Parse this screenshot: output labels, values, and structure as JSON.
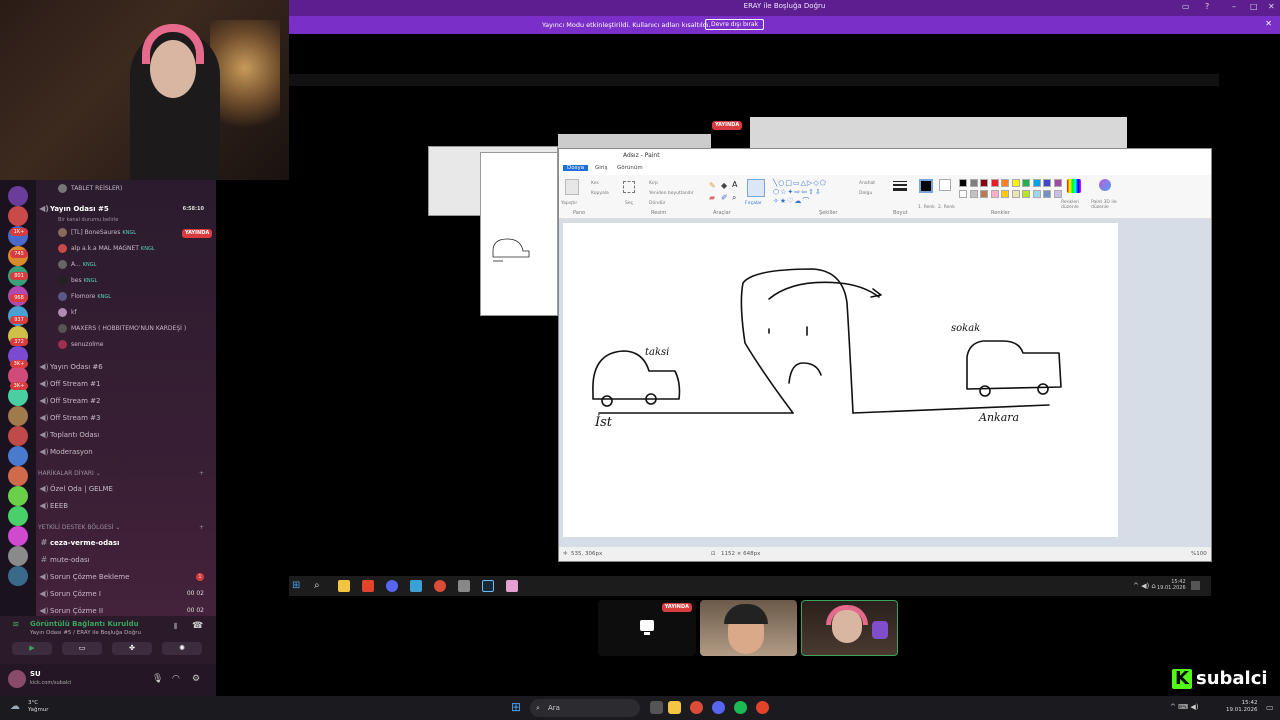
{
  "window": {
    "title": "ERAY ile Boşluğa Doğru",
    "notice_text": "Yayıncı Modu etkinleştirildi. Kullanıcı adları kısaltıldı.",
    "notice_button": "Devre dışı bırak"
  },
  "discord": {
    "channels": [
      {
        "label": "TABLET REİSLER)",
        "type": "voice-user"
      },
      {
        "label": "Yayın Odası #5",
        "type": "voice-active",
        "timer": "6:58:10",
        "subtitle": "Bir kanal durumu belirle"
      },
      {
        "label": "Yayın Odası #6",
        "type": "voice"
      },
      {
        "label": "Off Stream #1",
        "type": "voice"
      },
      {
        "label": "Off Stream #2",
        "type": "voice"
      },
      {
        "label": "Off Stream #3",
        "type": "voice"
      },
      {
        "label": "Toplantı Odası",
        "type": "voice"
      },
      {
        "label": "Moderasyon",
        "type": "voice"
      }
    ],
    "voice_users": [
      {
        "name": "[TL] BoneSaures",
        "tag": "KNGL",
        "live": "YAYINDA"
      },
      {
        "name": "alp a.k.a MAL MAGNET",
        "tag": "KNGL"
      },
      {
        "name": "A...",
        "tag": "KNGL"
      },
      {
        "name": "bes",
        "tag": "KNGL"
      },
      {
        "name": "Flomore",
        "tag": "KNGL"
      },
      {
        "name": "kf",
        "tag": ""
      },
      {
        "name": "MAXERS ( HOBBITEMO'NUN KARDEŞİ )",
        "tag": ""
      },
      {
        "name": "senuzolme",
        "tag": ""
      }
    ],
    "section_harikalar": "HARİKALAR DİYARI",
    "harikalar": [
      "Özel Oda | GELME",
      "EEEB"
    ],
    "section_destek": "YETKİLİ DESTEK BÖLGESİ",
    "destek": [
      {
        "label": "ceza-verme-odası",
        "type": "text",
        "bright": true
      },
      {
        "label": "mute-odası",
        "type": "text"
      },
      {
        "label": "Sorun Çözme Bekleme",
        "type": "voice",
        "badge": "1"
      },
      {
        "label": "Sorun Çözme I",
        "type": "voice",
        "count": "00  02"
      },
      {
        "label": "Sorun Çözme II",
        "type": "voice",
        "count": "00  02"
      }
    ],
    "connection_title": "Görüntülü Bağlantı Kuruldu",
    "connection_sub": "Yayın Odası #5 / ERAY ile Boşluğa Doğru",
    "user_name": "SU",
    "user_sub": "kick.com/subalci",
    "guild_badges": [
      "1K+",
      "745",
      "801",
      "968",
      "937",
      "372",
      "3K+",
      "3K+"
    ]
  },
  "paint": {
    "title": "Adsız - Paint",
    "tabs": [
      "Dosya",
      "Giriş",
      "Görünüm"
    ],
    "groups": [
      "Pano",
      "Resim",
      "Araçlar",
      "Şekiller",
      "Boyut",
      "Renkler"
    ],
    "tools": [
      "Yapıştır",
      "Kes",
      "Kopyala",
      "Seç",
      "Kırp",
      "Yeniden boyutlandır",
      "Döndür",
      "Fırçalar",
      "Anahat",
      "Dolgu",
      "1. Renk",
      "2. Renk",
      "Renkleri düzenle",
      "Paint 3D ile düzenle"
    ],
    "drawing_labels": [
      "İst",
      "Ankara",
      "taksi",
      "sokak"
    ],
    "status_pos": "535, 306px",
    "status_size": "1152 × 648px",
    "zoom": "%100",
    "palette": [
      "#000000",
      "#7f7f7f",
      "#880015",
      "#ed1c24",
      "#ff7f27",
      "#fff200",
      "#22b14c",
      "#00a2e8",
      "#3f48cc",
      "#a349a4",
      "#ffffff",
      "#c3c3c3",
      "#b97a57",
      "#ffaec9",
      "#ffc90e",
      "#efe4b0",
      "#b5e61d",
      "#99d9ea",
      "#7092be",
      "#c8bfe7"
    ]
  },
  "inner_taskbar": {
    "clock_time": "15:42",
    "clock_date": "19.01.2026"
  },
  "participants": {
    "live_badge": "YAYINDA"
  },
  "kick": {
    "brand": "subalci"
  },
  "taskbar": {
    "weather_temp": "3°C",
    "weather_desc": "Yağmur",
    "search_placeholder": "Ara",
    "time": "15:42",
    "date": "19.01.2026"
  },
  "colors": {
    "discord_purple": "#5d1f8f",
    "notice_purple": "#7b2fc9",
    "kick_green": "#53fc18",
    "live_red": "#d83c3e"
  }
}
